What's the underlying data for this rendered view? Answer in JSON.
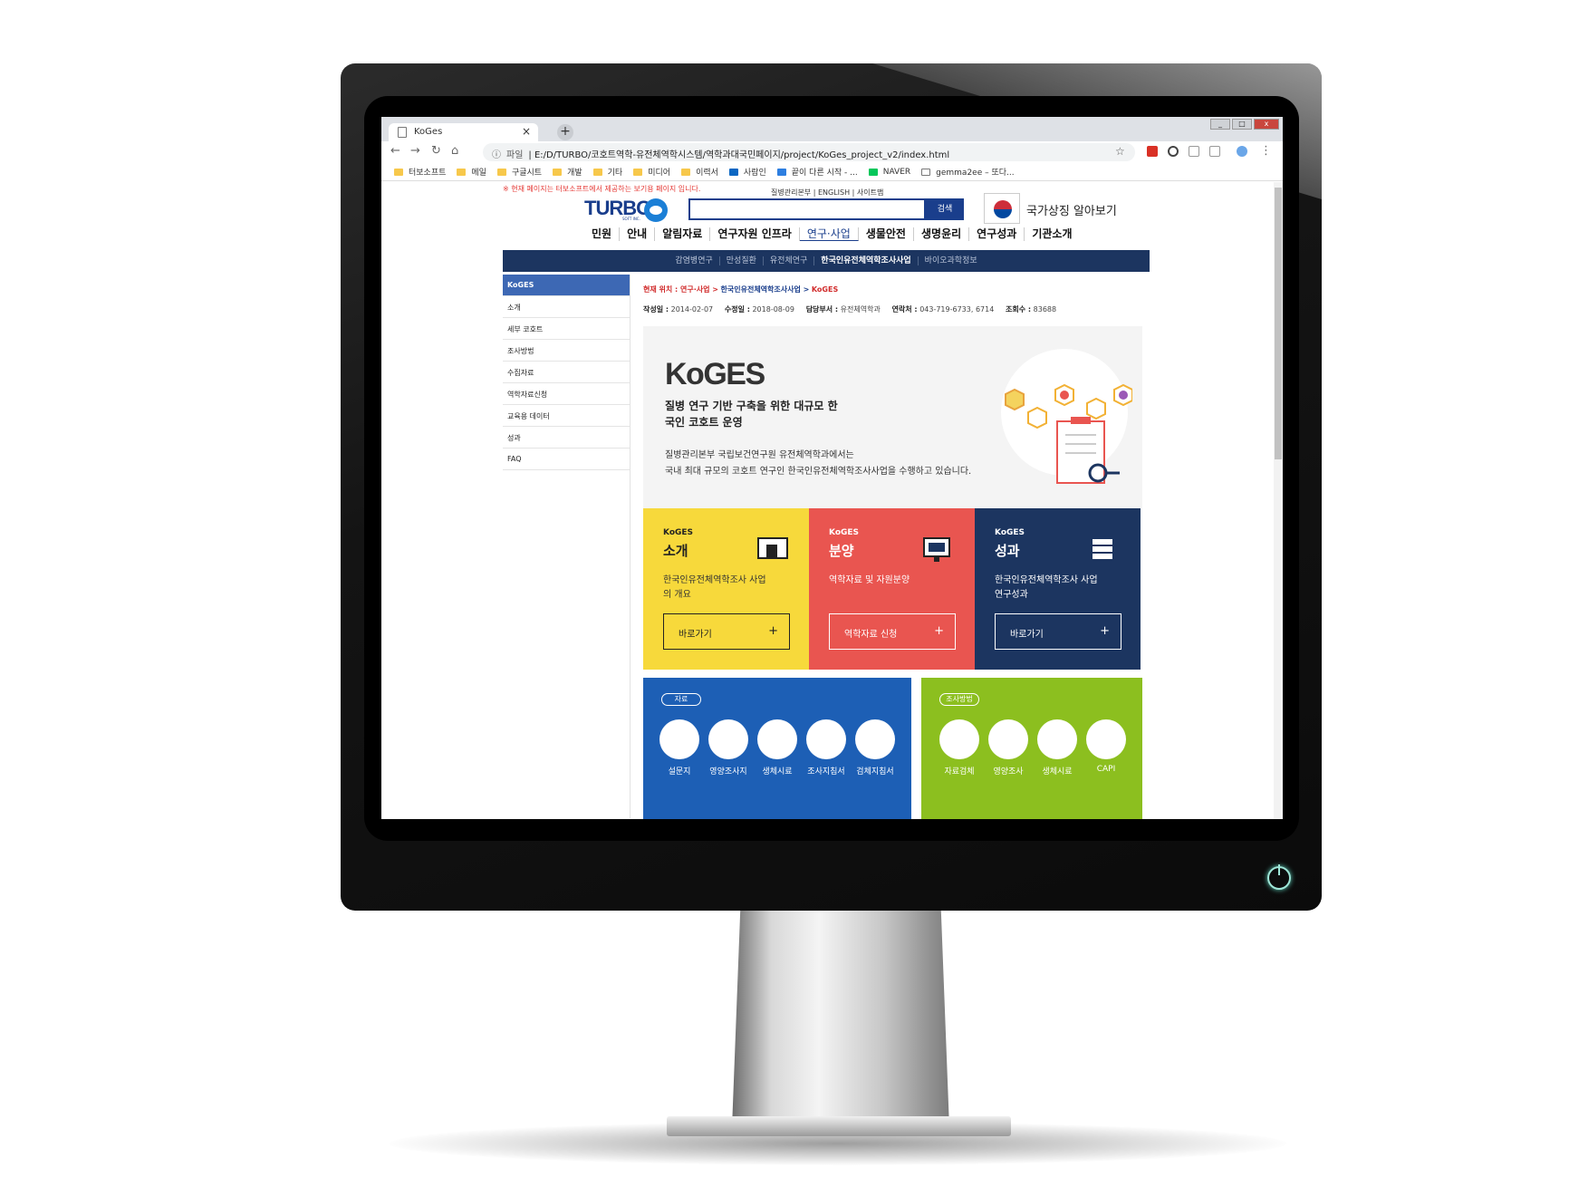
{
  "browser": {
    "tab_title": "KoGes",
    "tab_close": "×",
    "new_tab": "+",
    "url_label": "파일",
    "url": "E:/D/TURBO/코호트역학-유전체역학시스템/역학과대국민페이지/project/KoGes_project_v2/index.html",
    "bookmarks": [
      "터보소프트",
      "메일",
      "구글시트",
      "개발",
      "기타",
      "미디어",
      "이력서",
      "사람인",
      "끝이 다른 시작 - ...",
      "NAVER",
      "gemma2ee – 또다..."
    ]
  },
  "site": {
    "notice": "※ 현재 페이지는 터보소프트에서 제공하는 보기용 페이지 입니다.",
    "util_links": "질병관리본부 | ENGLISH | 사이트맵",
    "logo_text": "TURBO",
    "logo_sub": "SOFT INC.",
    "search_button": "검색",
    "flag_label": "국가상징 알아보기",
    "gnb": [
      "민원",
      "안내",
      "알림자료",
      "연구자원 인프라",
      "연구·사업",
      "생물안전",
      "생명윤리",
      "연구성과",
      "기관소개"
    ],
    "gnb_active": "연구·사업",
    "sub_nav": [
      "감염병연구",
      "만성질환",
      "유전체연구",
      "한국인유전체역학조사사업",
      "바이오과학정보"
    ],
    "sub_nav_active": "한국인유전체역학조사사업",
    "lnb": [
      "KoGES",
      "소개",
      "세부 코호트",
      "조사방법",
      "수집자료",
      "역학자료신청",
      "교육용 데이터",
      "성과",
      "FAQ"
    ],
    "location": {
      "label": "현재 위치 : 연구·사업 >",
      "path": "한국인유전체역학조사사업 >",
      "current": "KoGES"
    },
    "meta": {
      "created_label": "작성일 :",
      "created": "2014-02-07",
      "modified_label": "수정일 :",
      "modified": "2018-08-09",
      "dept_label": "담당부서 :",
      "dept": "유전체역학과",
      "phone_label": "연락처 :",
      "phone": "043-719-6733, 6714",
      "views_label": "조회수 :",
      "views": "83688"
    },
    "hero": {
      "title": "KoGES",
      "subtitle": "질병 연구 기반 구축을 위한 대규모 한국인 코호트 운영",
      "desc_line1": "질병관리본부 국립보건연구원 유전체역학과에서는",
      "desc_line2": "국내 최대 규모의 코호트 연구인 한국인유전체역학조사사업을 수행하고 있습니다."
    },
    "tiles": [
      {
        "kicker": "KoGES",
        "title": "소개",
        "desc": "한국인유전체역학조사 사업의 개요",
        "button": "바로가기",
        "plus": "+",
        "bg": "#f7d93b"
      },
      {
        "kicker": "KoGES",
        "title": "분양",
        "desc": "역학자료 및 자원분양",
        "button": "역학자료 신청",
        "plus": "+",
        "bg": "#e95550"
      },
      {
        "kicker": "KoGES",
        "title": "성과",
        "desc": "한국인유전체역학조사 사업 연구성과",
        "button": "바로가기",
        "plus": "+",
        "bg": "#1c3560"
      }
    ],
    "panels": [
      {
        "pill": "자료",
        "items": [
          "설문지",
          "영양조사지",
          "생체시료",
          "조사지침서",
          "검체지침서"
        ],
        "bg": "#1d5fb5"
      },
      {
        "pill": "조사방법",
        "items": [
          "자료검체",
          "영양조사",
          "생체시료",
          "CAPI"
        ],
        "bg": "#8cbf1f"
      }
    ]
  }
}
